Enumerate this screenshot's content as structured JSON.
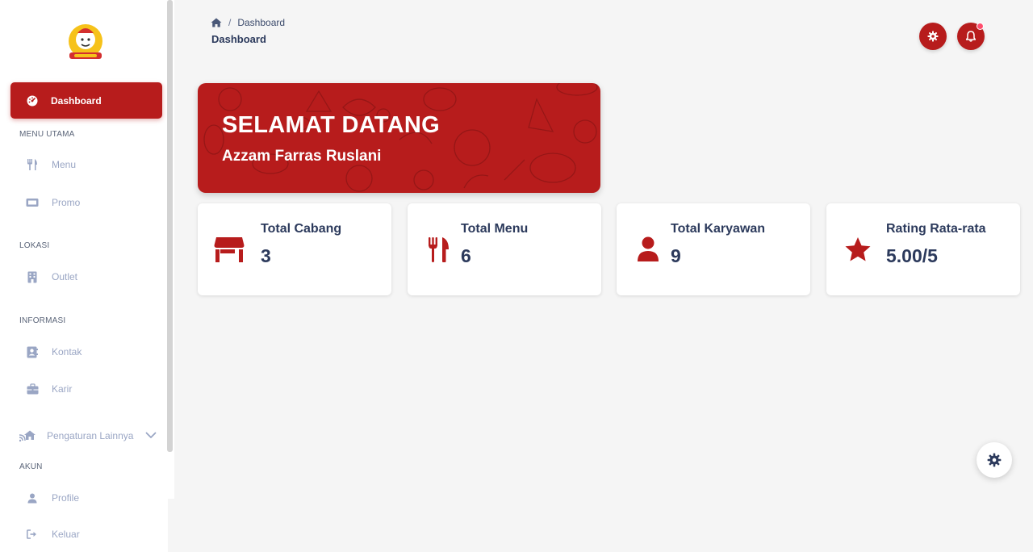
{
  "sidebar": {
    "logo": "restaurant-logo",
    "active_item": {
      "label": "Dashboard",
      "icon": "dashboard-gauge-icon"
    },
    "sections": {
      "menu_utama": "MENU UTAMA",
      "lokasi": "LOKASI",
      "informasi": "INFORMASI",
      "akun": "AKUN"
    },
    "items": {
      "menu": {
        "label": "Menu",
        "icon": "utensils-icon"
      },
      "promo": {
        "label": "Promo",
        "icon": "ticket-icon"
      },
      "outlet": {
        "label": "Outlet",
        "icon": "building-icon"
      },
      "kontak": {
        "label": "Kontak",
        "icon": "address-book-icon"
      },
      "karir": {
        "label": "Karir",
        "icon": "briefcase-icon"
      },
      "pengaturan": {
        "label": "Pengaturan Lainnya",
        "icon": "house-signal-icon"
      },
      "profile": {
        "label": "Profile",
        "icon": "user-icon"
      },
      "keluar": {
        "label": "Keluar",
        "icon": "sign-out-icon"
      }
    }
  },
  "header": {
    "breadcrumb": {
      "current": "Dashboard"
    },
    "page_title": "Dashboard",
    "settings_icon": "gear-icon",
    "notification_icon": "bell-icon"
  },
  "banner": {
    "title": "SELAMAT DATANG",
    "user_name": "Azzam Farras Ruslani"
  },
  "stats": [
    {
      "label": "Total Cabang",
      "value": "3",
      "icon": "store-icon"
    },
    {
      "label": "Total Menu",
      "value": "6",
      "icon": "utensils-icon"
    },
    {
      "label": "Total Karyawan",
      "value": "9",
      "icon": "user-icon"
    },
    {
      "label": "Rating Rata-rata",
      "value": "5.00/5",
      "icon": "star-icon"
    }
  ],
  "colors": {
    "brand": "#b71c1c",
    "text_dark": "#2c3a5c",
    "sidebar_muted": "#9aa6c4",
    "background": "#f5f5f5"
  }
}
